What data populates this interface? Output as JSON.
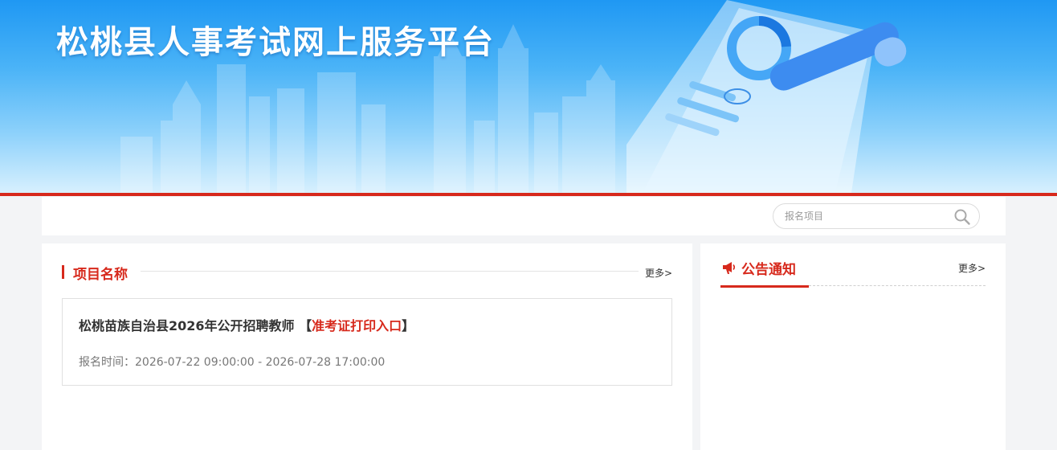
{
  "header": {
    "title": "松桃县人事考试网上服务平台"
  },
  "search": {
    "placeholder": "报名项目",
    "icon": "search-icon"
  },
  "projects": {
    "section_title": "项目名称",
    "more_label": "更多>",
    "items": [
      {
        "title": "松桃苗族自治县2026年公开招聘教师",
        "bracket_open": "【",
        "link_label": "准考证打印入口",
        "bracket_close": "】",
        "time_label": "报名时间：",
        "time_range": "2026-07-22 09:00:00 - 2026-07-28 17:00:00"
      }
    ]
  },
  "notices": {
    "section_title": "公告通知",
    "more_label": "更多>",
    "icon": "megaphone-icon"
  },
  "colors": {
    "accent": "#d7291c",
    "banner_top": "#1f98f3",
    "background": "#f3f4f6"
  }
}
